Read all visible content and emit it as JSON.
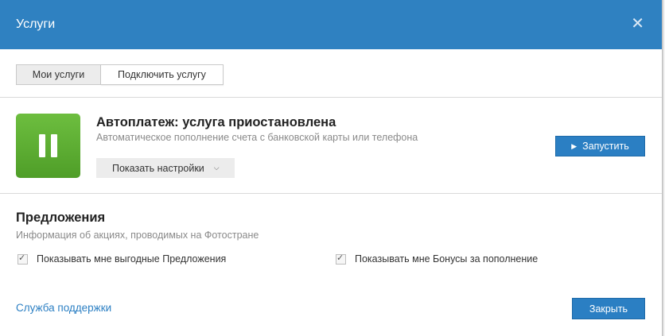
{
  "header": {
    "title": "Услуги",
    "close_symbol": "✕"
  },
  "tabs": [
    {
      "label": "Мои услуги",
      "active": true
    },
    {
      "label": "Подключить услугу",
      "active": false
    }
  ],
  "service": {
    "icon": "pause-icon",
    "icon_color": "#5aae31",
    "title": "Автоплатеж: услуга приостановлена",
    "description": "Автоматическое пополнение счета с банковской карты или телефона",
    "settings_label": "Показать настройки",
    "start_label": "Запустить"
  },
  "offers": {
    "title": "Предложения",
    "subtitle": "Информация об акциях, проводимых на Фотостране",
    "options": [
      {
        "label": "Показывать мне выгодные Предложения",
        "checked": true
      },
      {
        "label": "Показывать мне Бонусы за пополнение",
        "checked": true
      }
    ]
  },
  "footer": {
    "support_label": "Служба поддержки",
    "close_label": "Закрыть"
  },
  "colors": {
    "header": "#2f81c1",
    "accent": "#2b7fc3"
  }
}
